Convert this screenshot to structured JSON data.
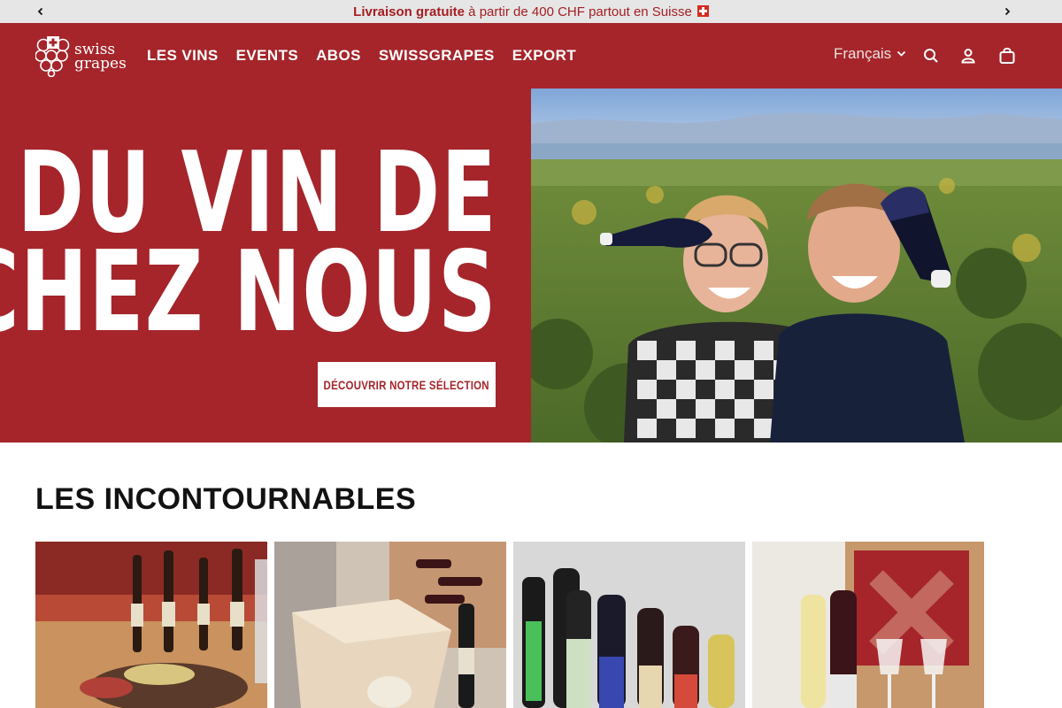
{
  "announcement": {
    "strong": "Livraison gratuite",
    "rest": " à partir de 400 CHF partout en Suisse",
    "prev_icon": "chevron-left-icon",
    "next_icon": "chevron-right-icon",
    "flag": "swiss-flag-icon"
  },
  "brand": {
    "line1": "swiss",
    "line2": "grapes"
  },
  "nav": [
    "LES VINS",
    "EVENTS",
    "ABOS",
    "SWISSGRAPES",
    "EXPORT"
  ],
  "header": {
    "language": "Français",
    "icons": [
      "search-icon",
      "account-icon",
      "cart-icon"
    ]
  },
  "hero": {
    "title_line1": "DU VIN DE",
    "title_line2": "CHEZ NOUS",
    "cta": "DÉCOUVRIR NOTRE SÉLECTION"
  },
  "section": {
    "title": "LES INCONTOURNABLES"
  },
  "colors": {
    "brand_red": "#a5252b",
    "announcement_bg": "#e6e6e6",
    "announcement_text": "#a51e22"
  }
}
